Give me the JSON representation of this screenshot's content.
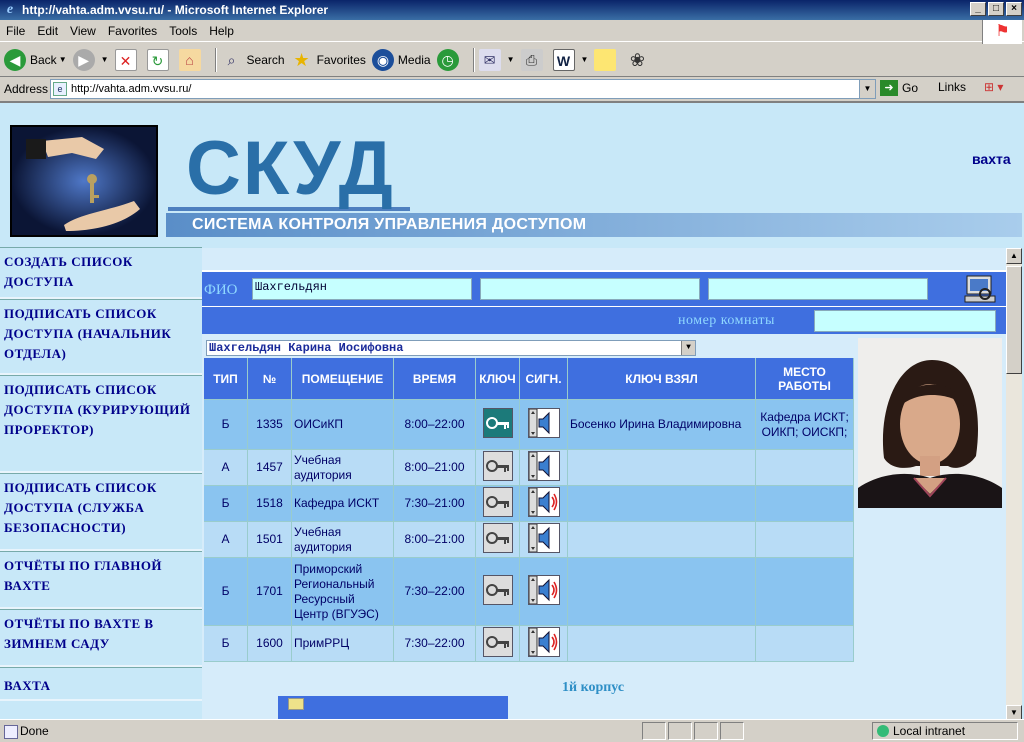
{
  "window": {
    "title": "http://vahta.adm.vvsu.ru/ - Microsoft Internet Explorer",
    "controls": [
      "_",
      "□",
      "×"
    ]
  },
  "menu": [
    "File",
    "Edit",
    "View",
    "Favorites",
    "Tools",
    "Help"
  ],
  "toolbar": {
    "back": "Back",
    "search": "Search",
    "favorites": "Favorites",
    "media": "Media"
  },
  "address": {
    "label": "Address",
    "url": "http://vahta.adm.vvsu.ru/",
    "go": "Go",
    "links": "Links"
  },
  "header": {
    "logo_text": "СКУД",
    "subtitle": "СИСТЕМА КОНТРОЛЯ УПРАВЛЕНИЯ ДОСТУПОМ",
    "top_link": "вахта"
  },
  "nav": [
    {
      "label": "СОЗДАТЬ СПИСОК ДОСТУПА"
    },
    {
      "label": "ПОДПИСАТЬ СПИСОК ДОСТУПА (НАЧАЛЬНИК ОТДЕЛА)"
    },
    {
      "label": "ПОДПИСАТЬ СПИСОК ДОСТУПА (КУРИРУЮЩИЙ ПРОРЕКТОР)"
    },
    {
      "label": "ПОДПИСАТЬ СПИСОК ДОСТУПА (СЛУЖБА БЕЗОПАСНОСТИ)"
    },
    {
      "label": "ОТЧЁТЫ ПО ГЛАВНОЙ ВАХТЕ"
    },
    {
      "label": "ОТЧЁТЫ ПО ВАХТЕ В ЗИМНЕМ САДУ"
    },
    {
      "label": "ВАХТА"
    }
  ],
  "form": {
    "fio_label": "ФИО",
    "fio_value": "Шахгельдян",
    "fio2": "",
    "fio3": "",
    "room_label": "номер комнаты",
    "room_value": "",
    "selected_person": "Шахгельдян Карина Иосифовна"
  },
  "table": {
    "headers": [
      "ТИП",
      "№",
      "ПОМЕЩЕНИЕ",
      "ВРЕМЯ",
      "КЛЮЧ",
      "СИГН.",
      "КЛЮЧ ВЗЯЛ",
      "МЕСТО РАБОТЫ"
    ],
    "rows": [
      {
        "type": "Б",
        "num": "1335",
        "room": "ОИСиКП",
        "time": "8:00–22:00",
        "key_taken": true,
        "signal": "off",
        "taken_by": "Босенко Ирина Владимировна",
        "work": "Кафедра ИСКТ; ОИКП; ОИСКП;"
      },
      {
        "type": "А",
        "num": "1457",
        "room": "Учебная аудитория",
        "time": "8:00–21:00",
        "key_taken": false,
        "signal": "off",
        "taken_by": "",
        "work": ""
      },
      {
        "type": "Б",
        "num": "1518",
        "room": "Кафедра ИСКТ",
        "time": "7:30–21:00",
        "key_taken": false,
        "signal": "on",
        "taken_by": "",
        "work": ""
      },
      {
        "type": "А",
        "num": "1501",
        "room": "Учебная аудитория",
        "time": "8:00–21:00",
        "key_taken": false,
        "signal": "off",
        "taken_by": "",
        "work": ""
      },
      {
        "type": "Б",
        "num": "1701",
        "room": "Приморский Региональный Ресурсный Центр (ВГУЭС)",
        "time": "7:30–22:00",
        "key_taken": false,
        "signal": "on",
        "taken_by": "",
        "work": ""
      },
      {
        "type": "Б",
        "num": "1600",
        "room": "ПримРРЦ",
        "time": "7:30–22:00",
        "key_taken": false,
        "signal": "on",
        "taken_by": "",
        "work": ""
      }
    ]
  },
  "footer": {
    "corpus": "1й корпус"
  },
  "status": {
    "text": "Done",
    "zone": "Local intranet"
  }
}
